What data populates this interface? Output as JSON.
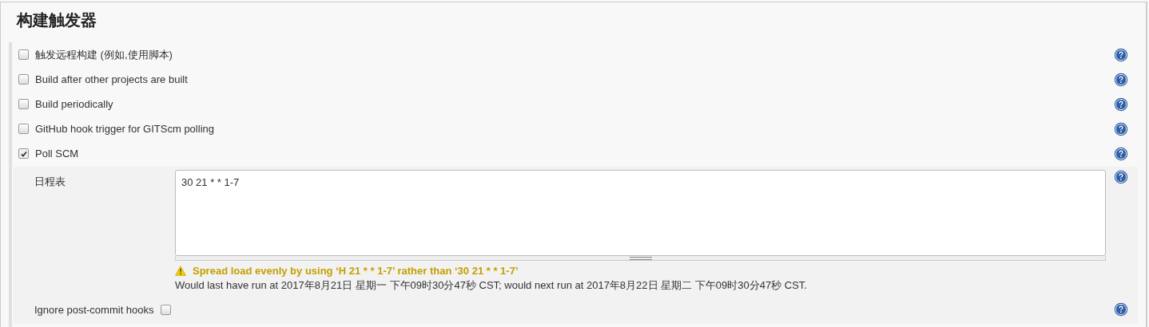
{
  "title": "构建触发器",
  "triggers": [
    {
      "label": "触发远程构建 (例如,使用脚本)",
      "checked": false
    },
    {
      "label": "Build after other projects are built",
      "checked": false
    },
    {
      "label": "Build periodically",
      "checked": false
    },
    {
      "label": "GitHub hook trigger for GITScm polling",
      "checked": false
    },
    {
      "label": "Poll SCM",
      "checked": true
    }
  ],
  "poll_scm": {
    "schedule_label": "日程表",
    "schedule_value": "30 21 * * 1-7",
    "warning": "Spread load evenly by using ‘H 21 * * 1-7’ rather than ‘30 21 * * 1-7’",
    "info": "Would last have run at 2017年8月21日 星期一 下午09时30分47秒 CST; would next run at 2017年8月22日 星期二 下午09时30分47秒 CST.",
    "ignore_hooks": {
      "label": "Ignore post-commit hooks",
      "checked": false
    }
  }
}
